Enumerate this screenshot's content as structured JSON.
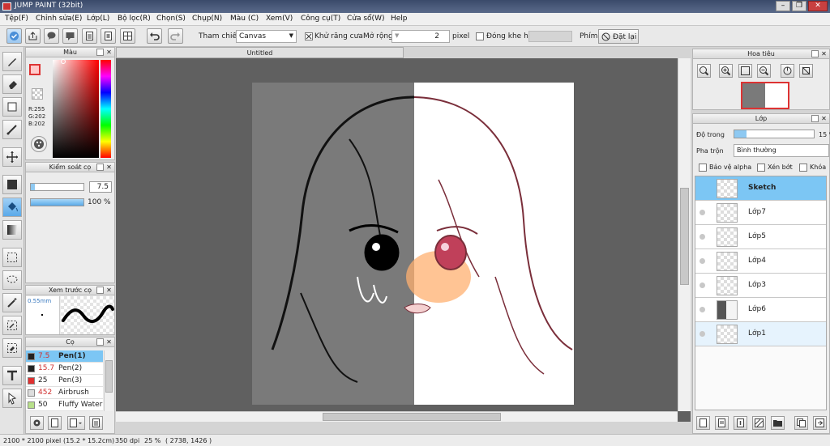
{
  "window": {
    "title": "JUMP PAINT (32bit)"
  },
  "menu": [
    "Tệp(F)",
    "Chỉnh sửa(E)",
    "Lớp(L)",
    "Bộ lọc(R)",
    "Chọn(S)",
    "Chụp(N)",
    "Màu (C)",
    "Xem(V)",
    "Công cụ(T)",
    "Cửa sổ(W)",
    "Help"
  ],
  "toolbar": {
    "reference_label": "Tham chiếu",
    "reference_value": "Canvas",
    "antialias_label": "Khử răng cưa",
    "expand_label": "Mở rộng",
    "expand_value": "2",
    "expand_unit": "pixel",
    "close_gap_label": "Đóng khe hở",
    "keys_label": "Phím",
    "reset_label": "Đặt lại"
  },
  "color_panel": {
    "title": "Màu",
    "r": "R:255",
    "g": "G:202",
    "b": "B:202",
    "primary": "#ffcaca",
    "secondary": "#f5e08a"
  },
  "brush_control": {
    "title": "Kiểm soát cọ",
    "size_value": "7.5",
    "opacity_value": "100 %",
    "opacity_fraction": 1.0
  },
  "brush_preview": {
    "title": "Xem trước cọ",
    "size": "0.55mm"
  },
  "brush_list": {
    "title": "Cọ",
    "items": [
      {
        "size": "7.5",
        "name": "Pen(1)",
        "color": "#222222",
        "selected": true
      },
      {
        "size": "15.7",
        "name": "Pen(2)",
        "color": "#222222",
        "selected": false
      },
      {
        "size": "25",
        "name": "Pen(3)",
        "color": "#e03030",
        "selected": false
      },
      {
        "size": "452",
        "name": "Airbrush",
        "color": "#dddddd",
        "selected": false
      },
      {
        "size": "50",
        "name": "Fluffy Water",
        "color": "#b8e08a",
        "selected": false
      }
    ]
  },
  "document": {
    "tab": "Untitled"
  },
  "navigator": {
    "title": "Hoa tiêu"
  },
  "layers": {
    "title": "Lớp",
    "opacity_label": "Độ trong",
    "opacity_value": "15 %",
    "opacity_fraction": 0.15,
    "blend_label": "Pha trộn",
    "blend_value": "Bình thường",
    "protect_alpha": "Bảo vệ alpha",
    "clip": "Xén bớt",
    "lock": "Khóa",
    "items": [
      {
        "name": "Sketch",
        "selected": true,
        "visible": true
      },
      {
        "name": "Lớp7",
        "selected": false,
        "visible": false
      },
      {
        "name": "Lớp5",
        "selected": false,
        "visible": false
      },
      {
        "name": "Lớp4",
        "selected": false,
        "visible": false
      },
      {
        "name": "Lớp3",
        "selected": false,
        "visible": false
      },
      {
        "name": "Lớp6",
        "selected": false,
        "visible": false
      },
      {
        "name": "Lớp1",
        "selected": false,
        "visible": false
      }
    ]
  },
  "status": {
    "size": "2100 * 2100 pixel",
    "physical": "(15.2 * 15.2cm)",
    "dpi": "350 dpi",
    "zoom": "25 %",
    "coords": "( 2738, 1426 )"
  }
}
